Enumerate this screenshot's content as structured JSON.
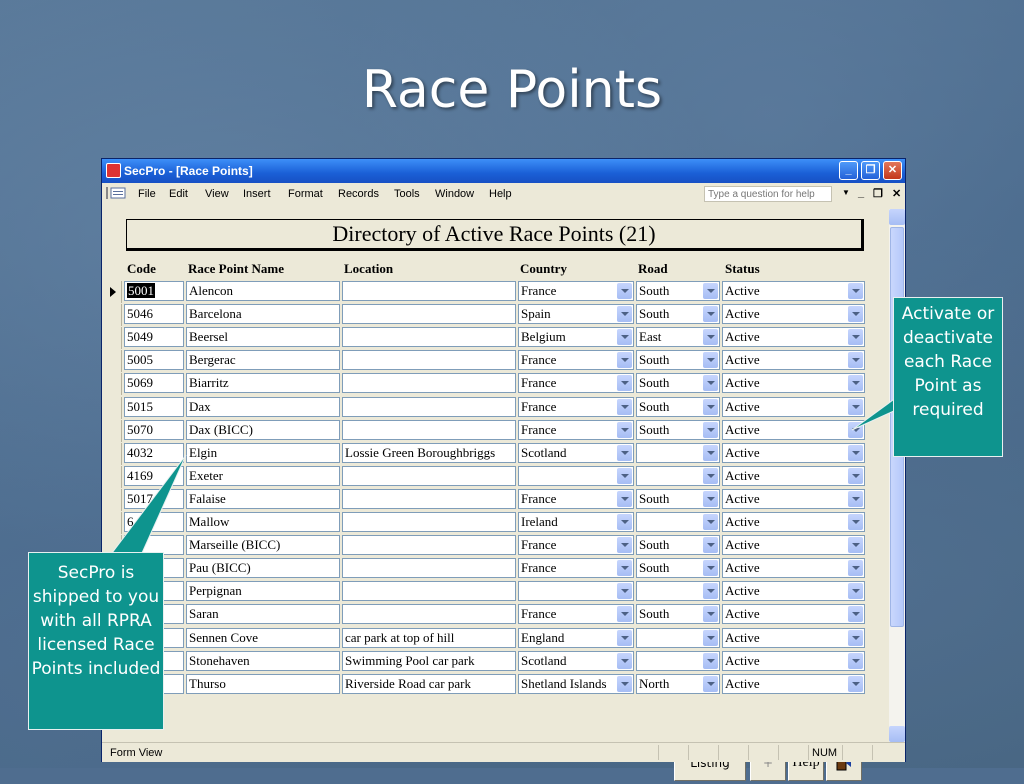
{
  "slide": {
    "title": "Race Points"
  },
  "window": {
    "title": "SecPro - [Race Points]",
    "menu": [
      "File",
      "Edit",
      "View",
      "Insert",
      "Format",
      "Records",
      "Tools",
      "Window",
      "Help"
    ],
    "question_placeholder": "Type a question for help"
  },
  "form": {
    "header": "Directory of Active Race Points (21)",
    "columns": {
      "code": "Code",
      "name": "Race Point Name",
      "location": "Location",
      "country": "Country",
      "road": "Road",
      "status": "Status"
    },
    "rows": [
      {
        "code": "5001",
        "name": "Alencon",
        "location": "",
        "country": "France",
        "road": "South",
        "status": "Active"
      },
      {
        "code": "5046",
        "name": "Barcelona",
        "location": "",
        "country": "Spain",
        "road": "South",
        "status": "Active"
      },
      {
        "code": "5049",
        "name": "Beersel",
        "location": "",
        "country": "Belgium",
        "road": "East",
        "status": "Active"
      },
      {
        "code": "5005",
        "name": "Bergerac",
        "location": "",
        "country": "France",
        "road": "South",
        "status": "Active"
      },
      {
        "code": "5069",
        "name": "Biarritz",
        "location": "",
        "country": "France",
        "road": "South",
        "status": "Active"
      },
      {
        "code": "5015",
        "name": "Dax",
        "location": "",
        "country": "France",
        "road": "South",
        "status": "Active"
      },
      {
        "code": "5070",
        "name": "Dax (BICC)",
        "location": "",
        "country": "France",
        "road": "South",
        "status": "Active"
      },
      {
        "code": "4032",
        "name": "Elgin",
        "location": "Lossie Green Boroughbriggs",
        "country": "Scotland",
        "road": "",
        "status": "Active"
      },
      {
        "code": "4169",
        "name": "Exeter",
        "location": "",
        "country": "",
        "road": "",
        "status": "Active"
      },
      {
        "code": "5017",
        "name": "Falaise",
        "location": "",
        "country": "France",
        "road": "South",
        "status": "Active"
      },
      {
        "code": "6",
        "name": "Mallow",
        "location": "",
        "country": "Ireland",
        "road": "",
        "status": "Active"
      },
      {
        "code": "28",
        "name": "Marseille (BICC)",
        "location": "",
        "country": "France",
        "road": "South",
        "status": "Active"
      },
      {
        "code": "",
        "name": "Pau (BICC)",
        "location": "",
        "country": "France",
        "road": "South",
        "status": "Active"
      },
      {
        "code": "",
        "name": "Perpignan",
        "location": "",
        "country": "",
        "road": "",
        "status": "Active"
      },
      {
        "code": "",
        "name": "Saran",
        "location": "",
        "country": "France",
        "road": "South",
        "status": "Active"
      },
      {
        "code": "",
        "name": "Sennen Cove",
        "location": "car park at top of hill",
        "country": "England",
        "road": "",
        "status": "Active"
      },
      {
        "code": "",
        "name": "Stonehaven",
        "location": "Swimming Pool car park",
        "country": "Scotland",
        "road": "",
        "status": "Active"
      },
      {
        "code": "",
        "name": "Thurso",
        "location": "Riverside Road car park",
        "country": "Shetland Islands",
        "road": "North",
        "status": "Active"
      }
    ],
    "buttons": {
      "listing": "Listing",
      "new": "+",
      "help": "Help"
    }
  },
  "statusbar": {
    "mode": "Form View",
    "num": "NUM"
  },
  "callouts": {
    "right": "Activate or deactivate each Race Point as required",
    "left": "SecPro is shipped to you with all RPRA licensed Race Points included"
  },
  "colors": {
    "callout": "#0e948e",
    "slide_bg": "#4f6d8f",
    "titlebar": "#1a5fd6"
  }
}
